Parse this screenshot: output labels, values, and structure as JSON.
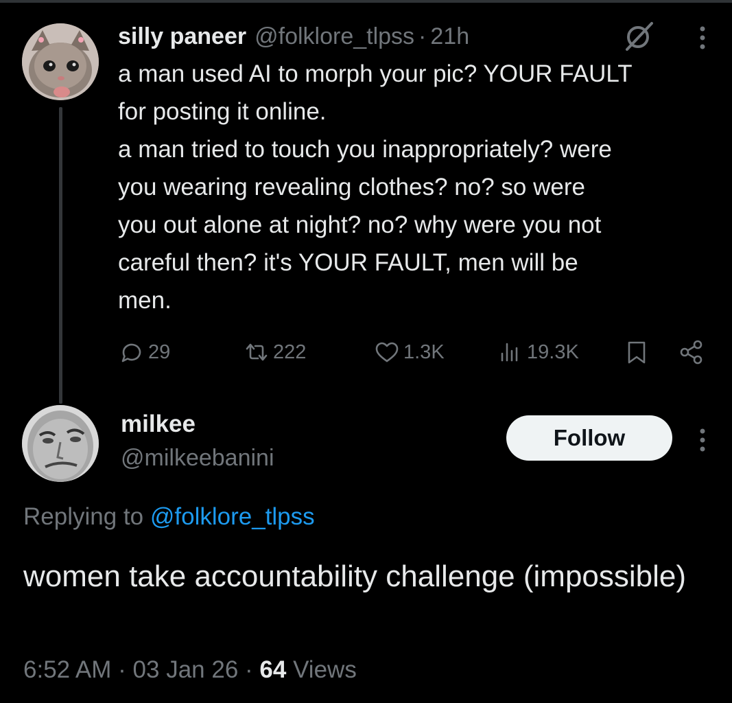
{
  "parent": {
    "display_name": "silly paneer",
    "handle": "@folklore_tlpss",
    "separator": "·",
    "time": "21h",
    "text": "a man used AI to morph your pic? YOUR FAULT\nfor posting it online.\na man tried to touch you inappropriately? were\nyou wearing revealing clothes? no? so were\nyou out alone at night? no? why were you not\ncareful then? it's YOUR FAULT, men will be\nmen.",
    "avatar_icon": "kitten-avatar",
    "stats": {
      "replies": "29",
      "reposts": "222",
      "likes": "1.3K",
      "views": "19.3K"
    }
  },
  "reply": {
    "display_name": "milkee",
    "handle": "@milkeebanini",
    "follow_label": "Follow",
    "replying_prefix": "Replying to",
    "replying_handle": "@folklore_tlpss",
    "text": "women take accountability challenge (impossible)",
    "time": "6:52 AM",
    "date": "03 Jan 26",
    "separator": "·",
    "views_count": "64",
    "views_label": "Views",
    "avatar_icon": "face-avatar"
  },
  "colors": {
    "background": "#000000",
    "text": "#e7e9ea",
    "muted": "#71767b",
    "link": "#1d9bf0",
    "button_bg": "#eff3f4"
  }
}
